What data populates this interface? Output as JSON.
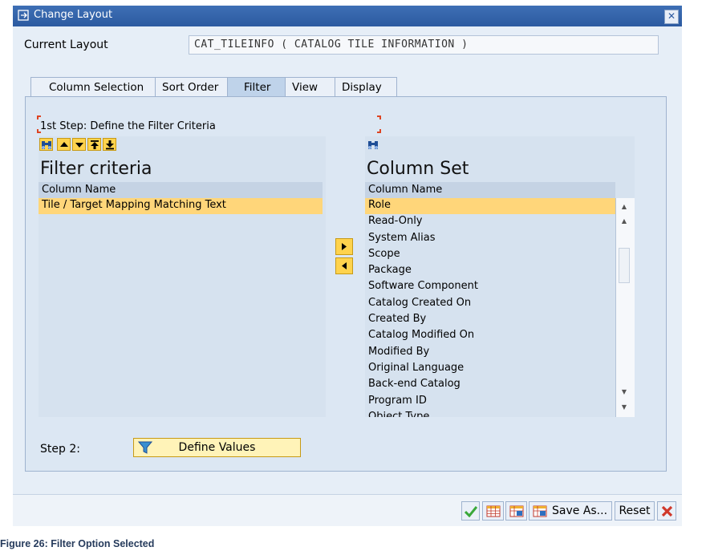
{
  "window": {
    "title": "Change Layout"
  },
  "current_layout": {
    "label": "Current Layout",
    "value": "CAT_TILEINFO ( CATALOG TILE INFORMATION )"
  },
  "tabs": [
    {
      "label": "Column Selection",
      "active": false
    },
    {
      "label": "Sort Order",
      "active": false
    },
    {
      "label": "Filter",
      "active": true
    },
    {
      "label": "View",
      "active": false
    },
    {
      "label": "Display",
      "active": false
    }
  ],
  "filter": {
    "step1_text": "1st Step: Define the Filter Criteria",
    "left": {
      "title": "Filter criteria",
      "column_header": "Column Name",
      "rows": [
        "Tile / Target Mapping Matching Text"
      ]
    },
    "right": {
      "title": "Column Set",
      "column_header": "Column Name",
      "rows": [
        "Role",
        "Read-Only",
        "System Alias",
        "Scope",
        "Package",
        "Software Component",
        "Catalog Created On",
        "Created By",
        "Catalog Modified On",
        "Modified By",
        "Original Language",
        "Back-end Catalog",
        "Program ID",
        "Object Type"
      ]
    },
    "step2_label": "Step 2:",
    "define_values_label": "Define Values"
  },
  "footer": {
    "save_as_label": "Save As...",
    "reset_label": "Reset"
  },
  "caption": "Figure 26: Filter Option Selected",
  "colors": {
    "title_bar": "#2c5aa0",
    "selected_row": "#ffd67a",
    "button_yellow": "#ffd34d"
  }
}
